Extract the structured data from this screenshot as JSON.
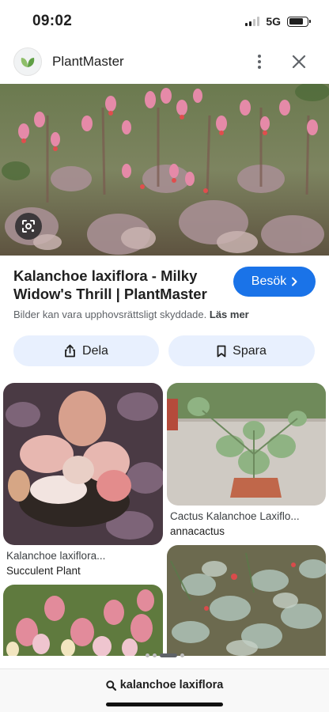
{
  "status_bar": {
    "time": "09:02",
    "network": "5G",
    "signal_bars_active": 2,
    "signal_bars_total": 4,
    "battery_level": 0.8
  },
  "header": {
    "app_name": "PlantMaster",
    "logo_icon": "leaf-icon",
    "menu_icon": "more-vert-icon",
    "close_icon": "close-icon"
  },
  "hero": {
    "lens_icon": "google-lens-icon"
  },
  "result": {
    "title": "Kalanchoe laxiflora - Milky Widow's Thrill | PlantMaster",
    "visit_label": "Besök",
    "copyright_text": "Bilder kan vara upphovsrättsligt skyddade.",
    "learn_more": "Läs mer"
  },
  "actions": {
    "share_label": "Dela",
    "save_label": "Spara"
  },
  "related": [
    {
      "title": "Kalanchoe laxiflora...",
      "source": "Succulent Plant"
    },
    {
      "title": "Cactus Kalanchoe Laxiflo...",
      "source": "annacactus"
    }
  ],
  "pager": {
    "count": 4,
    "active_index": 2
  },
  "bottom": {
    "query": "kalanchoe laxiflora",
    "search_icon": "search-icon"
  },
  "colors": {
    "accent": "#1a73e8",
    "chip_bg": "#e8f0fe"
  }
}
